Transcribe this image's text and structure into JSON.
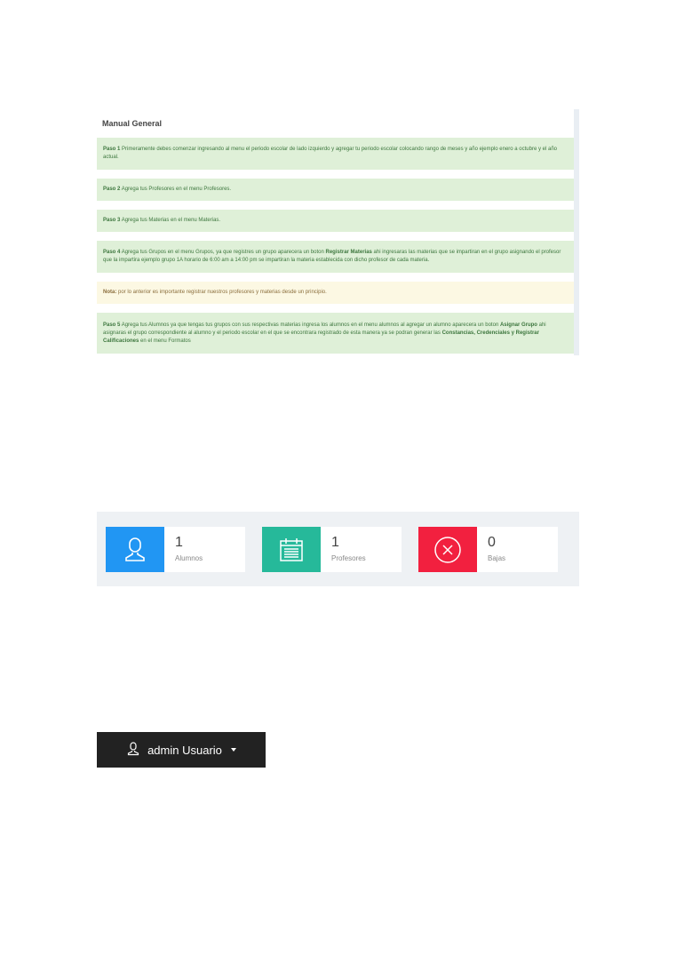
{
  "manual": {
    "title": "Manual General",
    "steps": [
      {
        "label": "Paso 1",
        "text": " Primeramente debes comenzar ingresando al menu el periodo escolar de lado izquierdo y agregar tu periodo escolar colocando rango de meses y año ejemplo enero a octubre y el año actual."
      },
      {
        "label": "Paso 2",
        "text": " Agrega tus Profesores en el menu Profesores."
      },
      {
        "label": "Paso 3",
        "text": " Agrega tus Materias en el menu Materias."
      },
      {
        "label": "Paso 4",
        "text_a": " Agrega tus Grupos en el menu Grupos, ya que registres un grupo aparecera un boton ",
        "bold_a": "Registrar Materias",
        "text_b": " ahi ingresaras las materias que se impartiran en el grupo asignando el profesor que la impartira ejemplo grupo 1A horario de 6:00 am a 14:00 pm se impartiran la materia establecida con dicho profesor de cada materia."
      },
      {
        "label": "Nota:",
        "text": " por lo anterior es importante registrar nuestros profesores y materias desde un principio."
      },
      {
        "label": "Paso 5",
        "text_a": " Agrega tus Alumnos ya que tengas tus grupos con sus respectivas materias ingresa los alumnos en el menu alumnos al agregar un alumno aparecera un boton ",
        "bold_a": "Asignar Grupo",
        "text_b": " ahi asignaras el grupo correspondiente al alumno y el periodo escolar en el que se encontrara registrado de esta manera ya se podran generar las ",
        "bold_b": "Constancias, Credenciales y Registrar Calificaciones",
        "text_c": " en el menu Formatos"
      }
    ]
  },
  "stats": [
    {
      "value": "1",
      "label": "Alumnos",
      "icon": "user-icon",
      "color": "#2196f3"
    },
    {
      "value": "1",
      "label": "Profesores",
      "icon": "calendar-icon",
      "color": "#26b99a"
    },
    {
      "value": "0",
      "label": "Bajas",
      "icon": "close-circle-icon",
      "color": "#f2203f"
    }
  ],
  "userbar": {
    "label": "admin Usuario",
    "icon": "user-icon"
  }
}
